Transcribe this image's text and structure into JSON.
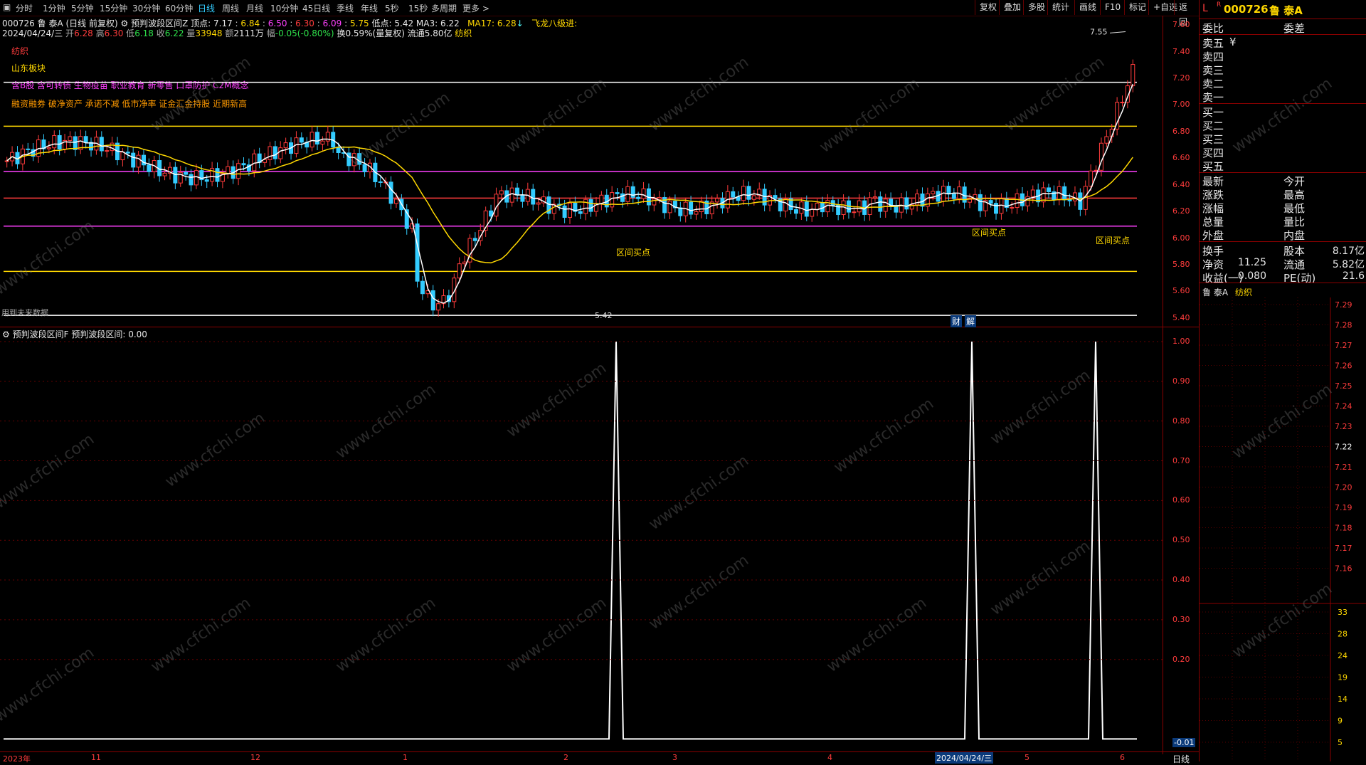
{
  "toolbar": {
    "periods": [
      "分时",
      "1分钟",
      "5分钟",
      "15分钟",
      "30分钟",
      "60分钟",
      "日线",
      "周线",
      "月线",
      "10分钟",
      "45日线",
      "季线",
      "年线",
      "5秒",
      "15秒",
      "多周期",
      "更多 >"
    ],
    "active_period": "日线",
    "right_buttons": [
      "复权",
      "叠加",
      "多股",
      "统计",
      "画线",
      "F10",
      "标记",
      "+自选",
      "返回"
    ]
  },
  "stock": {
    "code": "000726",
    "name": "鲁 泰A",
    "header_code": "000726",
    "header_name": "鲁 泰A",
    "flag_left": "L",
    "flag_r": "R"
  },
  "info_line1": {
    "title": "000726 鲁 泰A (日线 前复权)",
    "indicator": "预判波段区间Z",
    "top_label": "顶点:",
    "top_value": "7.17",
    "v2": "6.84",
    "v3": "6.50",
    "v4": "6.30",
    "v5": "6.09",
    "v6": "5.75",
    "low_label": "低点:",
    "low_value": "5.42",
    "ma3_label": "MA3:",
    "ma3_value": "6.22",
    "ma17_label": "MA17:",
    "ma17_value": "6.28",
    "ma17_arrow": "↓",
    "extra": "飞龙八级进:"
  },
  "info_line2": {
    "date": "2024/04/24/三",
    "open_label": "开",
    "open": "6.28",
    "high_label": "高",
    "high": "6.30",
    "low_label": "低",
    "low": "6.18",
    "close_label": "收",
    "close": "6.22",
    "vol_label": "量",
    "vol": "33948",
    "amt_label": "额",
    "amt": "2111万",
    "chg_label": "幅",
    "chg": "-0.05(-0.80%)",
    "turnover": "换0.59%(量复权)",
    "float": "流通5.80亿",
    "sector": "纺织"
  },
  "tags": {
    "sector": "纺织",
    "region": "山东板块",
    "concepts": "含B股 含可转债 生物疫苗 职业教育 新零售 口罩防护 C2M概念",
    "features": "融资融券 破净资产 承诺不减 低市净率 证金汇金持股 近期新高"
  },
  "chart_main": {
    "price_axis": [
      "7.60",
      "7.40",
      "7.20",
      "7.00",
      "6.80",
      "6.60",
      "6.40",
      "6.20",
      "6.00",
      "5.80",
      "5.60",
      "5.40"
    ],
    "level_lines": [
      {
        "value": 7.17,
        "color": "#ffffff"
      },
      {
        "value": 6.84,
        "color": "#ffd800"
      },
      {
        "value": 6.5,
        "color": "#ff40ff"
      },
      {
        "value": 6.3,
        "color": "#ff3c3c"
      },
      {
        "value": 6.09,
        "color": "#ff40ff"
      },
      {
        "value": 5.75,
        "color": "#ffd800"
      },
      {
        "value": 5.42,
        "color": "#ffffff"
      }
    ],
    "high_mark": "7.55",
    "low_mark": "5.42",
    "buy_labels": [
      "区间买点",
      "区间买点",
      "区间买点"
    ],
    "bottom_left_text": "用到未来数据",
    "finance_buttons": [
      "财",
      "解"
    ]
  },
  "chart_sub": {
    "title": "预判波段区间F",
    "value_label": "预判波段区间:",
    "value": "0.00",
    "axis": [
      "1.00",
      "0.90",
      "0.80",
      "0.70",
      "0.60",
      "0.50",
      "0.40",
      "0.30",
      "0.20",
      "-0.01"
    ]
  },
  "date_axis": {
    "labels": [
      "2023年",
      "11",
      "12",
      "1",
      "2",
      "3",
      "4",
      "2024/04/24/三",
      "5",
      "6"
    ],
    "period_label": "日线"
  },
  "quote_panel": {
    "bid_ratio_label": "委比",
    "bid_diff_label": "委差",
    "asks": [
      "卖五",
      "卖四",
      "卖三",
      "卖二",
      "卖一"
    ],
    "ask_currency": "¥",
    "bids": [
      "买一",
      "买二",
      "买三",
      "买四",
      "买五"
    ],
    "stats": [
      {
        "l": "最新",
        "m": "今开"
      },
      {
        "l": "涨跌",
        "m": "最高"
      },
      {
        "l": "涨幅",
        "m": "最低"
      },
      {
        "l": "总量",
        "m": "量比"
      },
      {
        "l": "外盘",
        "m": "内盘"
      }
    ],
    "fundamentals": [
      {
        "l": "换手",
        "lv": "",
        "m": "股本",
        "mv": "8.17亿"
      },
      {
        "l": "净资",
        "lv": "11.25",
        "m": "流通",
        "mv": "5.82亿"
      },
      {
        "l": "收益(一)",
        "lv": "0.080",
        "m": "PE(动)",
        "mv": "21.6"
      }
    ],
    "mini_title": "鲁 泰A",
    "mini_sector": "纺织",
    "mini_axis_price": [
      "7.29",
      "7.28",
      "7.27",
      "7.26",
      "7.25",
      "7.24",
      "7.23",
      "7.22",
      "7.21",
      "7.20",
      "7.19",
      "7.18",
      "7.17",
      "7.16"
    ],
    "mini_axis_vol": [
      "33",
      "28",
      "24",
      "19",
      "14",
      "9",
      "5"
    ]
  },
  "watermark": "www.cfchi.com"
}
